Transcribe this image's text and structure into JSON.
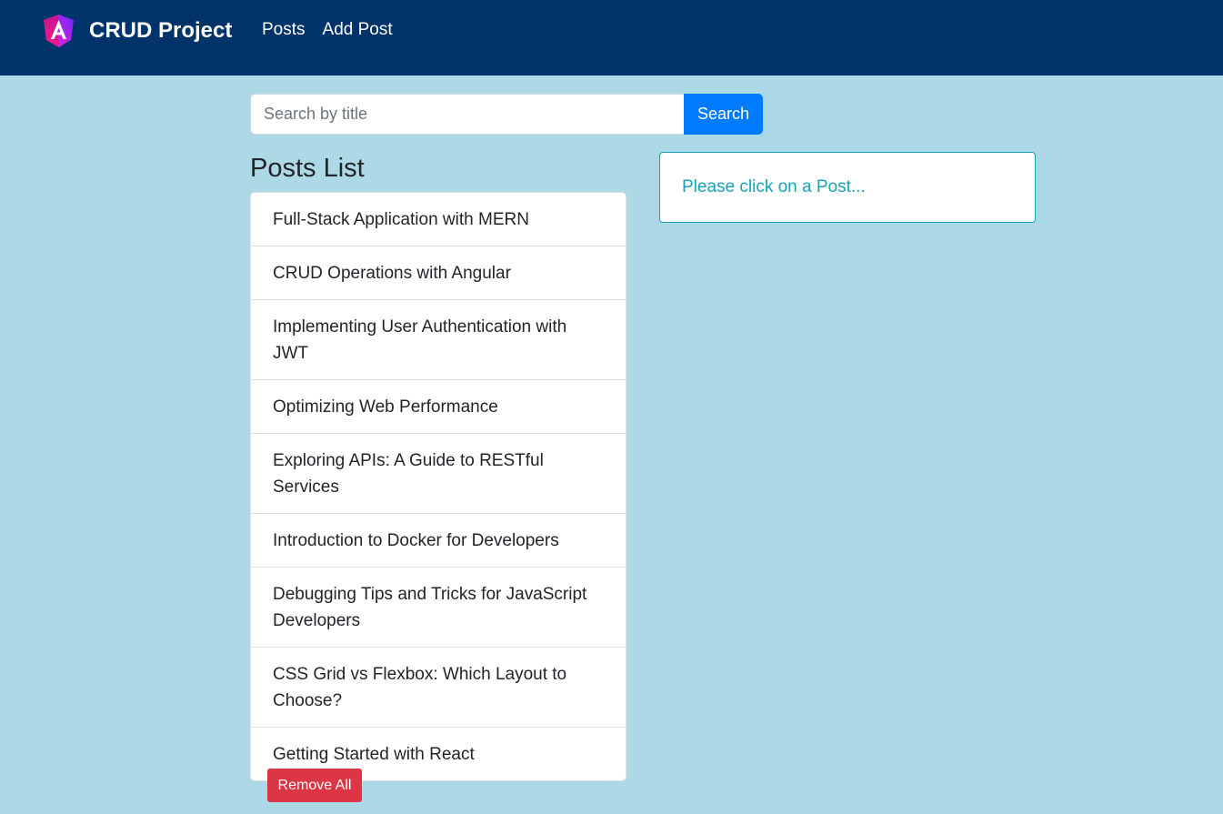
{
  "navbar": {
    "brand": "CRUD Project",
    "logo_icon": "angular-logo-icon",
    "links": [
      "Posts",
      "Add Post"
    ]
  },
  "search": {
    "placeholder": "Search by title",
    "value": "",
    "button_label": "Search"
  },
  "posts": {
    "title": "Posts List",
    "items": [
      "Full-Stack Application with MERN",
      "CRUD Operations with Angular",
      "Implementing User Authentication with JWT",
      "Optimizing Web Performance",
      "Exploring APIs: A Guide to RESTful Services",
      "Introduction to Docker for Developers",
      "Debugging Tips and Tricks for JavaScript Developers",
      "CSS Grid vs Flexbox: Which Layout to Choose?",
      "Getting Started with React"
    ],
    "remove_all_label": "Remove All"
  },
  "detail": {
    "message": "Please click on a Post..."
  },
  "colors": {
    "navbar_bg": "#00336a",
    "page_bg": "#add8e6",
    "primary": "#007bff",
    "danger": "#dc3545",
    "info": "#17a2b8"
  }
}
